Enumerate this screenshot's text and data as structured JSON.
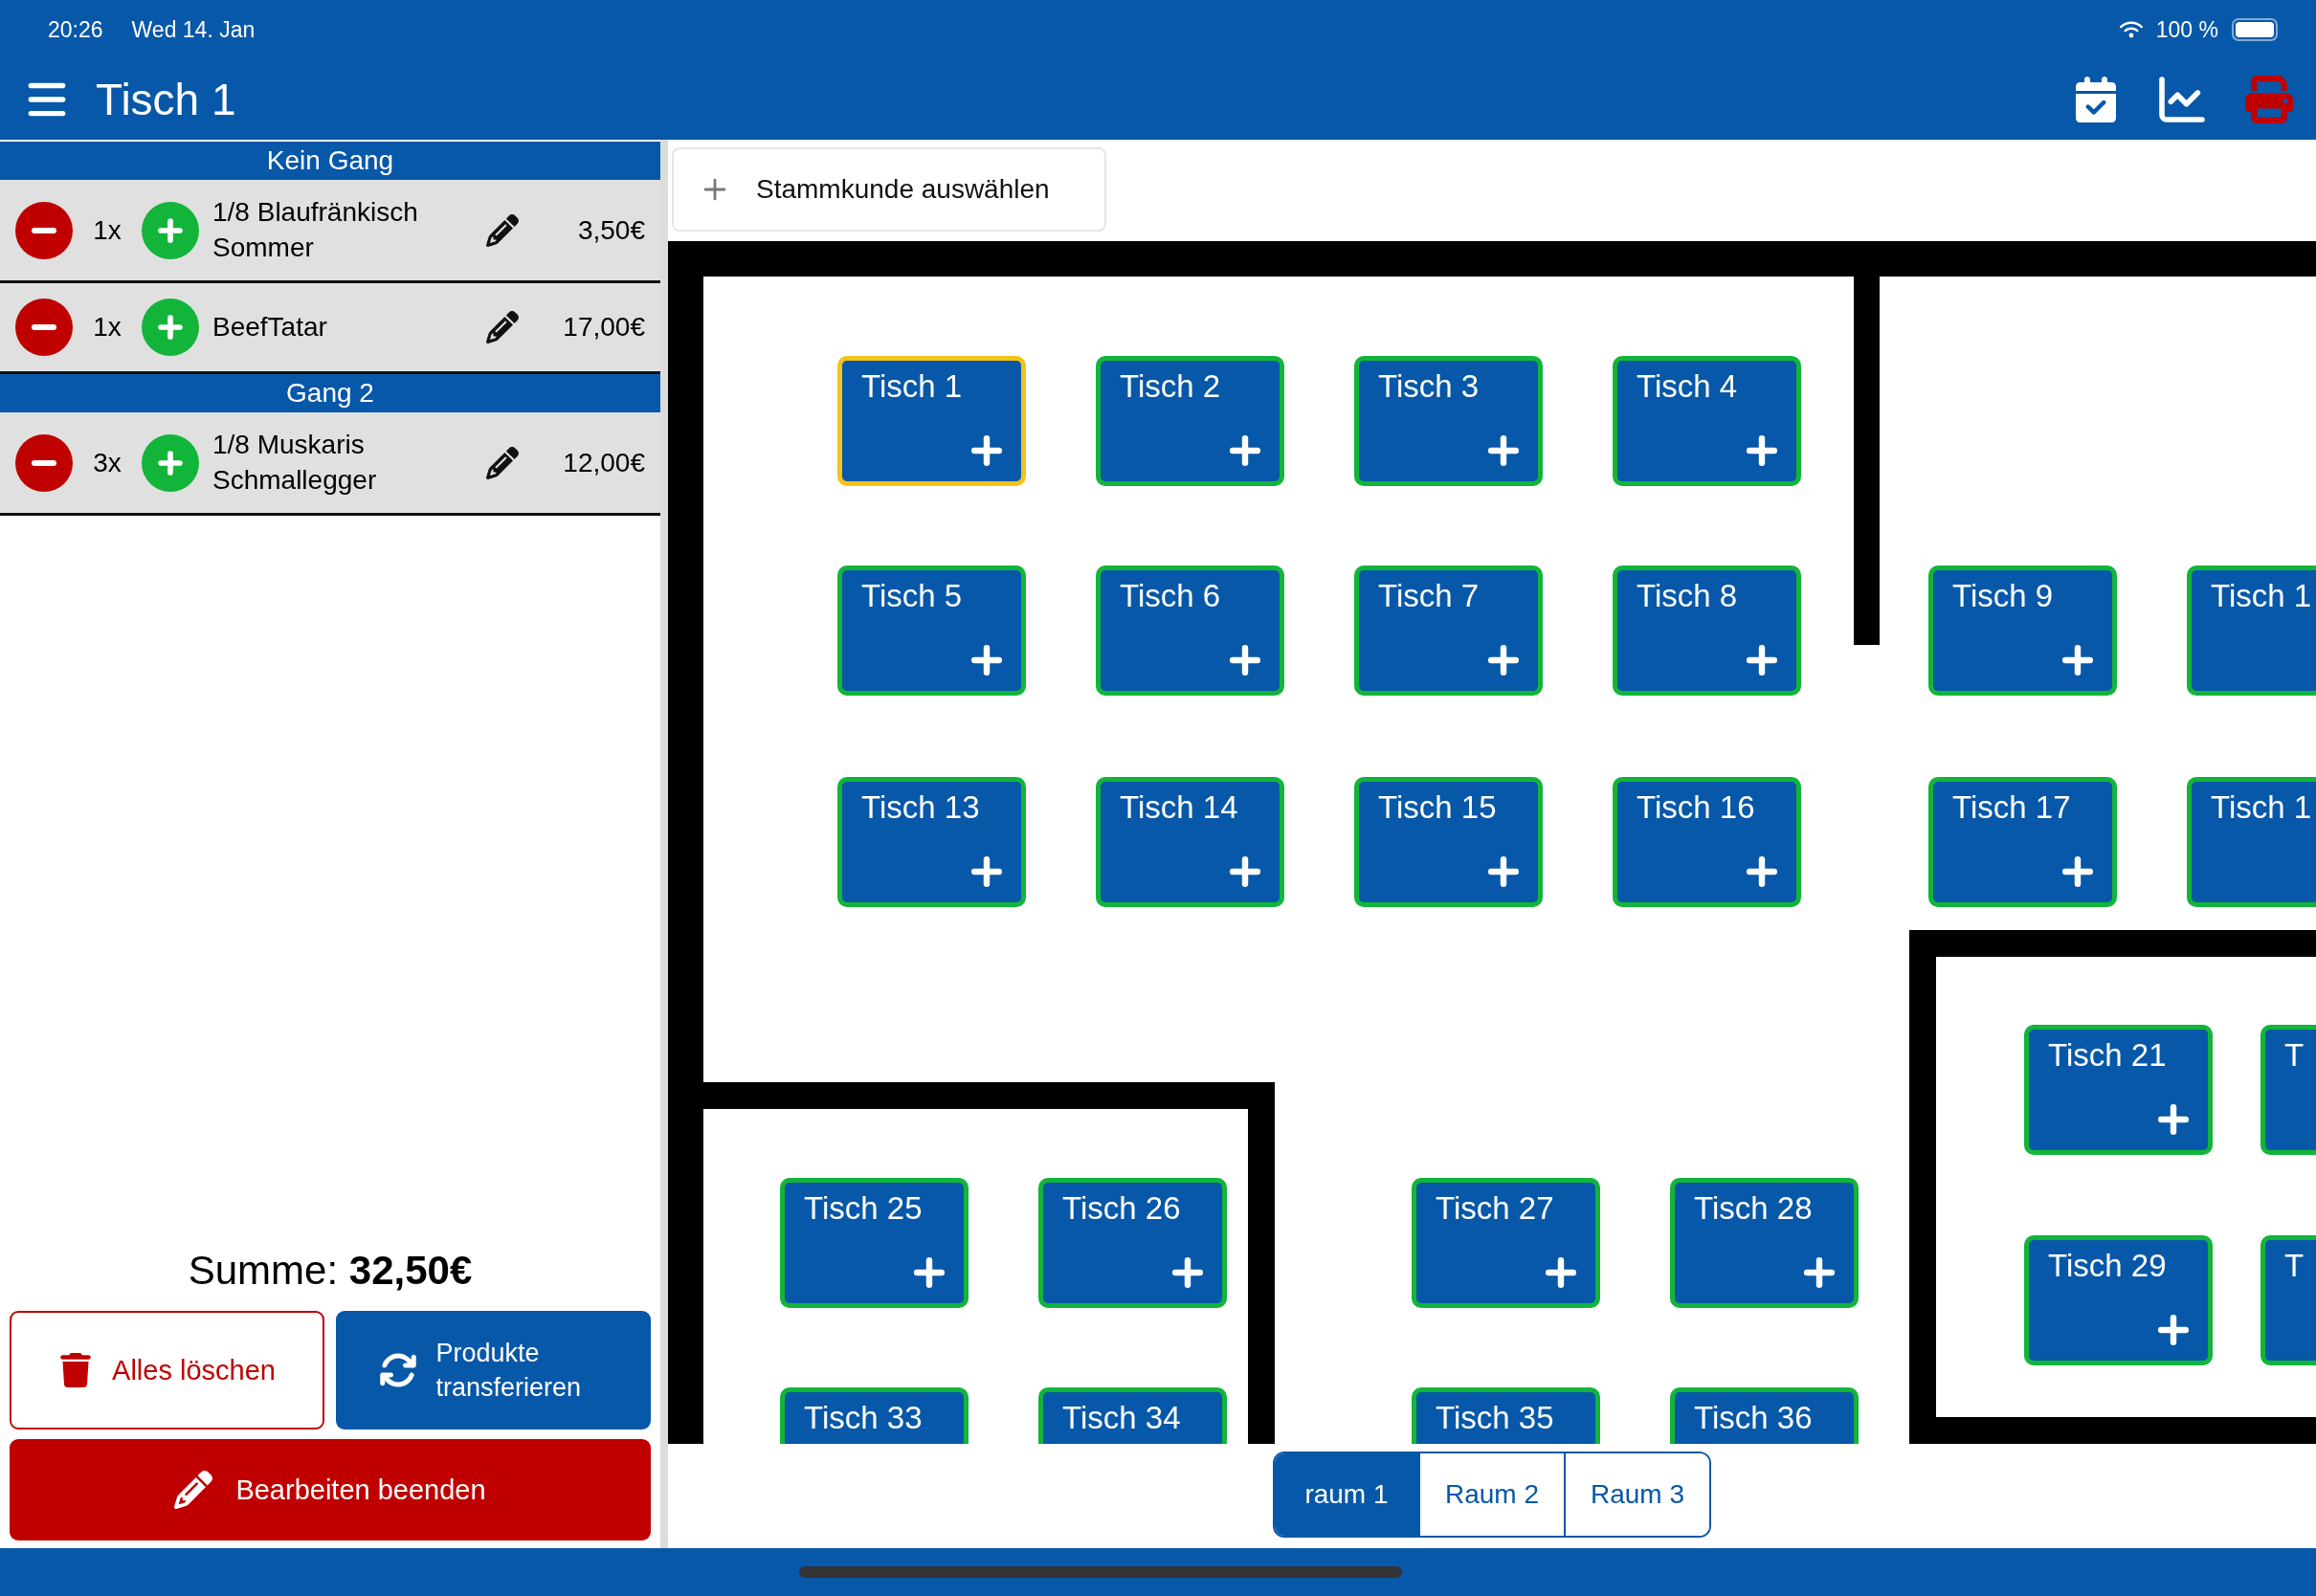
{
  "status_bar": {
    "time": "20:26",
    "date": "Wed 14. Jan",
    "battery": "100 %"
  },
  "header": {
    "title": "Tisch 1"
  },
  "order": {
    "groups": [
      {
        "title": "Kein Gang",
        "items": [
          {
            "qty": "1x",
            "name": "1/8 Blaufränkisch Sommer",
            "price": "3,50€"
          },
          {
            "qty": "1x",
            "name": "BeefTatar",
            "price": "17,00€"
          }
        ]
      },
      {
        "title": "Gang 2",
        "items": [
          {
            "qty": "3x",
            "name": "1/8 Muskaris Schmallegger",
            "price": "12,00€"
          }
        ]
      }
    ]
  },
  "total": "Summe: **32,50€**",
  "actions": {
    "clear": "Alles löschen",
    "transfer": "Produkte transferieren",
    "finish": "Bearbeiten beenden"
  },
  "customer_button": {
    "label": "Stammkunde auswählen"
  },
  "floor": {
    "tables": [
      {
        "label": "Tisch 1",
        "selected": true
      },
      {
        "label": "Tisch 2",
        "selected": false
      },
      {
        "label": "Tisch 3",
        "selected": false
      },
      {
        "label": "Tisch 4",
        "selected": false
      },
      {
        "label": "Tisch 5",
        "selected": false
      },
      {
        "label": "Tisch 6",
        "selected": false
      },
      {
        "label": "Tisch 7",
        "selected": false
      },
      {
        "label": "Tisch 8",
        "selected": false
      },
      {
        "label": "Tisch 9",
        "selected": false
      },
      {
        "label": "Tisch 1",
        "selected": false
      },
      {
        "label": "Tisch 13",
        "selected": false
      },
      {
        "label": "Tisch 14",
        "selected": false
      },
      {
        "label": "Tisch 15",
        "selected": false
      },
      {
        "label": "Tisch 16",
        "selected": false
      },
      {
        "label": "Tisch 17",
        "selected": false
      },
      {
        "label": "Tisch 1",
        "selected": false
      },
      {
        "label": "Tisch 21",
        "selected": false
      },
      {
        "label": "T",
        "selected": false
      },
      {
        "label": "Tisch 25",
        "selected": false
      },
      {
        "label": "Tisch 26",
        "selected": false
      },
      {
        "label": "Tisch 27",
        "selected": false
      },
      {
        "label": "Tisch 28",
        "selected": false
      },
      {
        "label": "Tisch 29",
        "selected": false
      },
      {
        "label": "T",
        "selected": false
      },
      {
        "label": "Tisch 33",
        "selected": false
      },
      {
        "label": "Tisch 34",
        "selected": false
      },
      {
        "label": "Tisch 35",
        "selected": false
      },
      {
        "label": "Tisch 36",
        "selected": false
      }
    ]
  },
  "rooms": [
    {
      "label": "raum 1",
      "selected": true
    },
    {
      "label": "Raum 2",
      "selected": false
    },
    {
      "label": "Raum 3",
      "selected": false
    }
  ]
}
